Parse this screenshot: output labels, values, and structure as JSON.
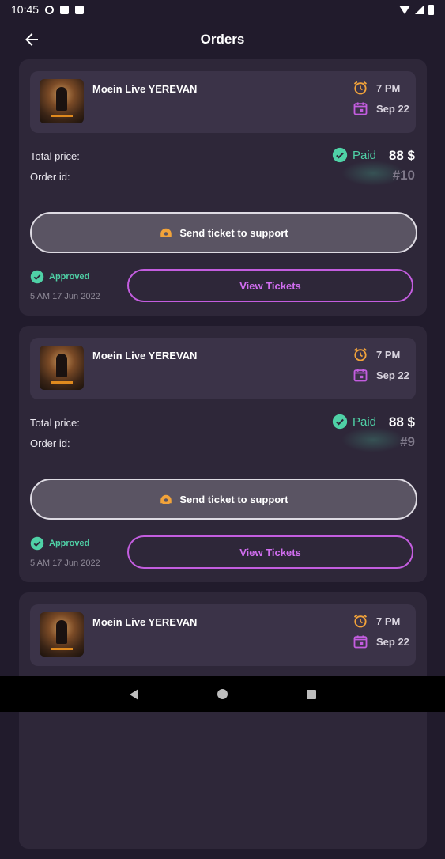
{
  "status_bar": {
    "time": "10:45"
  },
  "header": {
    "title": "Orders"
  },
  "labels": {
    "total_price": "Total price:",
    "order_id": "Order id:",
    "paid": "Paid",
    "send_ticket": "Send ticket to support",
    "approved": "Approved",
    "view_tickets": "View Tickets"
  },
  "orders": [
    {
      "event_title": "Moein Live YEREVAN",
      "time": "7 PM",
      "date": "Sep 22",
      "price": "88 $",
      "order_id": "#10",
      "approved_at": "5 AM  17 Jun 2022"
    },
    {
      "event_title": "Moein Live YEREVAN",
      "time": "7 PM",
      "date": "Sep 22",
      "price": "88 $",
      "order_id": "#9",
      "approved_at": "5 AM  17 Jun 2022"
    },
    {
      "event_title": "Moein Live YEREVAN",
      "time": "7 PM",
      "date": "Sep 22"
    }
  ],
  "colors": {
    "background": "#211b2c",
    "card": "#2e2739",
    "accent_purple": "#c35ddf",
    "paid_green": "#4fd1a6",
    "icon_orange": "#f2a33a"
  },
  "icons": [
    "back-arrow-icon",
    "alarm-clock-icon",
    "calendar-icon",
    "check-circle-icon",
    "support-ticket-icon"
  ]
}
